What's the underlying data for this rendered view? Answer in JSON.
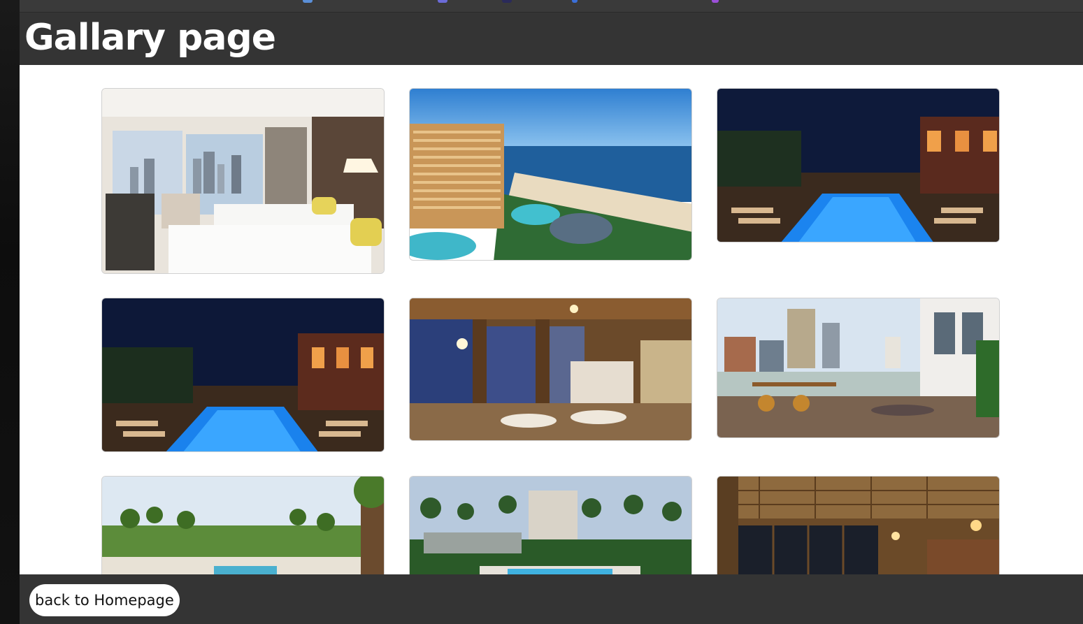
{
  "header": {
    "title": "Gallary page"
  },
  "gallery": {
    "images": [
      {
        "name": "hotel-bedroom-city-view"
      },
      {
        "name": "beach-resort-tower"
      },
      {
        "name": "rooftop-pool-night"
      },
      {
        "name": "rooftop-pool-night-2"
      },
      {
        "name": "restaurant-dining-hall"
      },
      {
        "name": "rooftop-terrace-bar"
      },
      {
        "name": "palm-resort-pool"
      },
      {
        "name": "hotel-pool-palms"
      },
      {
        "name": "wood-ceiling-lounge"
      }
    ]
  },
  "footer": {
    "back_label": "back to Homepage"
  }
}
